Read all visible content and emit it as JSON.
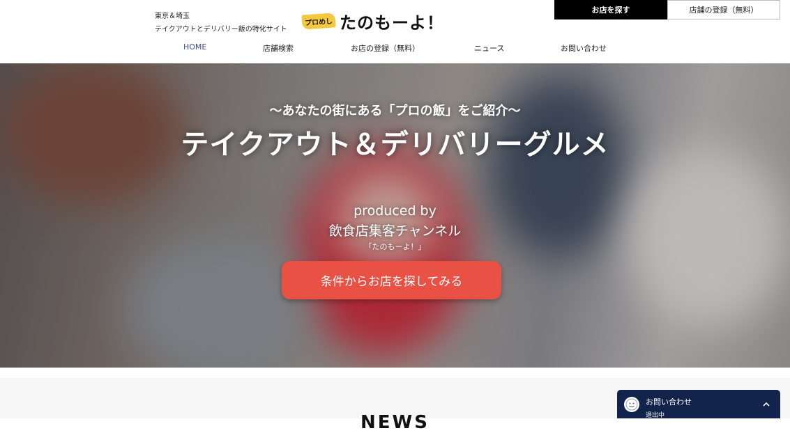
{
  "header": {
    "tagline_1": "東京＆埼玉",
    "tagline_2": "テイクアウトとデリバリー飯の特化サイト",
    "logo_badge": "プロめし",
    "logo_text": "たのもーよ！",
    "btn_find": "お店を探す",
    "btn_register": "店舗の登録（無料）",
    "nav": [
      "HOME",
      "店舗検索",
      "お店の登録（無料）",
      "ニュース",
      "お問い合わせ"
    ]
  },
  "hero": {
    "subtitle": "〜あなたの街にある「プロの飯」をご紹介〜",
    "title": "テイクアウト＆デリバリーグルメ",
    "produced_by": "produced by",
    "channel": "飲食店集客チャンネル",
    "site_name": "「たのもーよ！」",
    "cta_label": "条件からお店を探してみる"
  },
  "news": {
    "heading": "NEWS"
  },
  "chat": {
    "title": "お問い合わせ",
    "status": "退出中"
  },
  "colors": {
    "cta": "#e85144",
    "chat_bg": "#12244c",
    "nav_active": "#3b4f80",
    "logo_badge": "#f5c842"
  },
  "icons": [
    "avatar-icon",
    "chevron-up-icon"
  ]
}
